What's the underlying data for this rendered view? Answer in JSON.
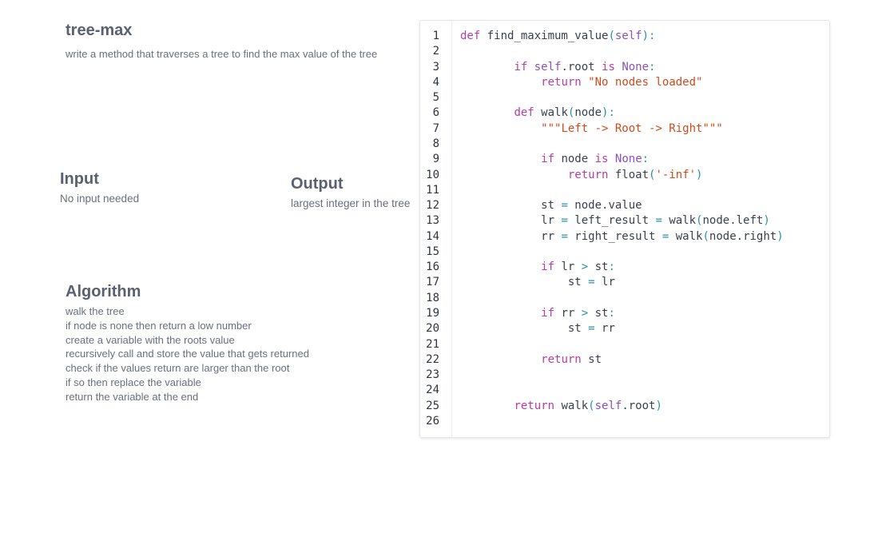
{
  "title": "tree-max",
  "description": "write a method that traverses a tree to find the max value of the tree",
  "input": {
    "heading": "Input",
    "text": "No input needed"
  },
  "output": {
    "heading": "Output",
    "text": "largest integer in the tree"
  },
  "algorithm": {
    "heading": "Algorithm",
    "lines": [
      "walk the tree",
      "if node is none then return a low number",
      "create a variable with the roots value",
      "recursively call and store the value that gets returned",
      "check if the values return are larger than the root",
      "if so then replace the variable",
      "return the variable at the end"
    ]
  },
  "code": {
    "lines": [
      [
        [
          "kw",
          "def "
        ],
        [
          "nm",
          "find_maximum_value"
        ],
        [
          "pn",
          "("
        ],
        [
          "sf",
          "self"
        ],
        [
          "pn",
          "):"
        ]
      ],
      [],
      [
        [
          "nm",
          "        "
        ],
        [
          "kw",
          "if "
        ],
        [
          "sf",
          "self"
        ],
        [
          "nm",
          ".root "
        ],
        [
          "kw",
          "is "
        ],
        [
          "sf",
          "None"
        ],
        [
          "pn",
          ":"
        ]
      ],
      [
        [
          "nm",
          "            "
        ],
        [
          "kw",
          "return "
        ],
        [
          "st",
          "\"No nodes loaded\""
        ]
      ],
      [],
      [
        [
          "nm",
          "        "
        ],
        [
          "kw",
          "def "
        ],
        [
          "nm",
          "walk"
        ],
        [
          "pn",
          "("
        ],
        [
          "nm",
          "node"
        ],
        [
          "pn",
          "):"
        ]
      ],
      [
        [
          "nm",
          "            "
        ],
        [
          "st",
          "\"\"\"Left -> Root -> Right\"\"\""
        ]
      ],
      [],
      [
        [
          "nm",
          "            "
        ],
        [
          "kw",
          "if "
        ],
        [
          "nm",
          "node "
        ],
        [
          "kw",
          "is "
        ],
        [
          "sf",
          "None"
        ],
        [
          "pn",
          ":"
        ]
      ],
      [
        [
          "nm",
          "                "
        ],
        [
          "kw",
          "return "
        ],
        [
          "nm",
          "float"
        ],
        [
          "pn",
          "("
        ],
        [
          "st",
          "'-inf'"
        ],
        [
          "pn",
          ")"
        ]
      ],
      [],
      [
        [
          "nm",
          "            st "
        ],
        [
          "op",
          "="
        ],
        [
          "nm",
          " node.value"
        ]
      ],
      [
        [
          "nm",
          "            lr "
        ],
        [
          "op",
          "="
        ],
        [
          "nm",
          " left_result "
        ],
        [
          "op",
          "="
        ],
        [
          "nm",
          " walk"
        ],
        [
          "pn",
          "("
        ],
        [
          "nm",
          "node.left"
        ],
        [
          "pn",
          ")"
        ]
      ],
      [
        [
          "nm",
          "            rr "
        ],
        [
          "op",
          "="
        ],
        [
          "nm",
          " right_result "
        ],
        [
          "op",
          "="
        ],
        [
          "nm",
          " walk"
        ],
        [
          "pn",
          "("
        ],
        [
          "nm",
          "node.right"
        ],
        [
          "pn",
          ")"
        ]
      ],
      [],
      [
        [
          "nm",
          "            "
        ],
        [
          "kw",
          "if "
        ],
        [
          "nm",
          "lr "
        ],
        [
          "op",
          ">"
        ],
        [
          "nm",
          " st"
        ],
        [
          "pn",
          ":"
        ]
      ],
      [
        [
          "nm",
          "                st "
        ],
        [
          "op",
          "="
        ],
        [
          "nm",
          " lr"
        ]
      ],
      [],
      [
        [
          "nm",
          "            "
        ],
        [
          "kw",
          "if "
        ],
        [
          "nm",
          "rr "
        ],
        [
          "op",
          ">"
        ],
        [
          "nm",
          " st"
        ],
        [
          "pn",
          ":"
        ]
      ],
      [
        [
          "nm",
          "                st "
        ],
        [
          "op",
          "="
        ],
        [
          "nm",
          " rr"
        ]
      ],
      [],
      [
        [
          "nm",
          "            "
        ],
        [
          "kw",
          "return "
        ],
        [
          "nm",
          "st"
        ]
      ],
      [],
      [],
      [
        [
          "nm",
          "        "
        ],
        [
          "kw",
          "return "
        ],
        [
          "nm",
          "walk"
        ],
        [
          "pn",
          "("
        ],
        [
          "sf",
          "self"
        ],
        [
          "nm",
          ".root"
        ],
        [
          "pn",
          ")"
        ]
      ],
      []
    ]
  }
}
